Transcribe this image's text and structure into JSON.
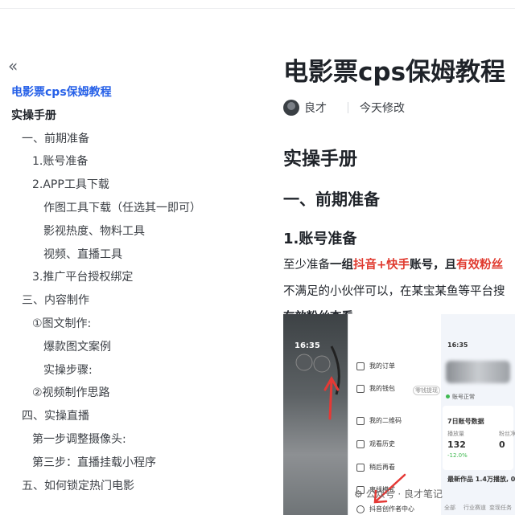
{
  "toc": {
    "collapse_icon": "«",
    "items": [
      {
        "text": "电影票cps保姆教程",
        "level": 0,
        "style": "active"
      },
      {
        "text": "实操手册",
        "level": 0,
        "style": "bold"
      },
      {
        "text": "一、前期准备",
        "level": 1
      },
      {
        "text": "1.账号准备",
        "level": 2
      },
      {
        "text": "2.APP工具下载",
        "level": 2
      },
      {
        "text": "作图工具下载（任选其一即可）",
        "level": 3
      },
      {
        "text": "影视热度、物料工具",
        "level": 3
      },
      {
        "text": "视频、直播工具",
        "level": 3
      },
      {
        "text": "3.推广平台授权绑定",
        "level": 2
      },
      {
        "text": "三、内容制作",
        "level": 1
      },
      {
        "text": "①图文制作:",
        "level": 2
      },
      {
        "text": "爆款图文案例",
        "level": 3
      },
      {
        "text": "实操步骤:",
        "level": 3
      },
      {
        "text": "②视频制作思路",
        "level": 2
      },
      {
        "text": "四、实操直播",
        "level": 1
      },
      {
        "text": "第一步调整摄像头:",
        "level": 2
      },
      {
        "text": "第三步：直播挂载小程序",
        "level": 2
      },
      {
        "text": "五、如何锁定热门电影",
        "level": 1
      }
    ]
  },
  "doc": {
    "title": "电影票cps保姆教程",
    "author": "良才",
    "modified": "今天修改",
    "h1": "实操手册",
    "h2": "一、前期准备",
    "h3": "1.账号准备",
    "para1": {
      "a": "至少准备",
      "b": "一组",
      "c": "抖音+快手",
      "d": "账号，",
      "e": "且",
      "f": "有效粉丝"
    },
    "para2": "不满足的小伙伴可以，在某宝某鱼等平台搜",
    "para3": "有效粉丝查看:"
  },
  "shots": {
    "time1": "16:35",
    "time2": "16:35",
    "menu": [
      "我的订单",
      "我的钱包",
      "我的二维码",
      "观看历史",
      "稍后再看",
      "离线模式",
      "抖音创作者中心"
    ],
    "wallet_tag": "零钱提现",
    "account_status": "账号正常",
    "data_title": "7日账号数据",
    "stat_labels": [
      "播放量",
      "粉丝净"
    ],
    "stat_values": [
      "132",
      "0"
    ],
    "stat_change": "-12.0%",
    "latest": "最新作品 1.4万播放, 0",
    "tabs": [
      "全部",
      "行业赛道",
      "变现任务"
    ]
  },
  "watermark": "公众号 · 良才笔记"
}
